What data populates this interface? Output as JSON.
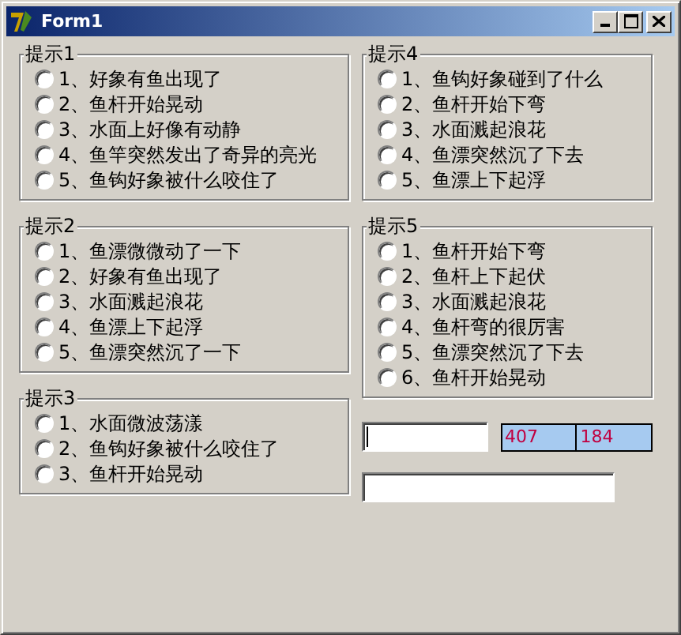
{
  "window": {
    "title": "Form1"
  },
  "left_groups": [
    {
      "title": "提示1",
      "options": [
        {
          "label": "1、好象有鱼出现了",
          "selected": false
        },
        {
          "label": "2、鱼杆开始晃动",
          "selected": false
        },
        {
          "label": "3、水面上好像有动静",
          "selected": false
        },
        {
          "label": "4、鱼竿突然发出了奇异的亮光",
          "selected": false
        },
        {
          "label": "5、鱼钩好象被什么咬住了",
          "selected": false
        }
      ]
    },
    {
      "title": "提示2",
      "options": [
        {
          "label": "1、鱼漂微微动了一下",
          "selected": false
        },
        {
          "label": "2、好象有鱼出现了",
          "selected": false
        },
        {
          "label": "3、水面溅起浪花",
          "selected": false
        },
        {
          "label": "4、鱼漂上下起浮",
          "selected": false
        },
        {
          "label": "5、鱼漂突然沉了一下",
          "selected": false
        }
      ]
    },
    {
      "title": "提示3",
      "options": [
        {
          "label": "1、水面微波荡漾",
          "selected": false
        },
        {
          "label": "2、鱼钩好象被什么咬住了",
          "selected": false
        },
        {
          "label": "3、鱼杆开始晃动",
          "selected": false
        }
      ]
    }
  ],
  "right_groups": [
    {
      "title": "提示4",
      "options": [
        {
          "label": "1、鱼钩好象碰到了什么",
          "selected": false
        },
        {
          "label": "2、鱼杆开始下弯",
          "selected": false
        },
        {
          "label": "3、水面溅起浪花",
          "selected": false
        },
        {
          "label": "4、鱼漂突然沉了下去",
          "selected": false
        },
        {
          "label": "5、鱼漂上下起浮",
          "selected": false
        }
      ]
    },
    {
      "title": "提示5",
      "options": [
        {
          "label": "1、鱼杆开始下弯",
          "selected": false
        },
        {
          "label": "2、鱼杆上下起伏",
          "selected": false
        },
        {
          "label": "3、水面溅起浪花",
          "selected": false
        },
        {
          "label": "4、鱼杆弯的很厉害",
          "selected": false
        },
        {
          "label": "5、鱼漂突然沉了下去",
          "selected": false
        },
        {
          "label": "6、鱼杆开始晃动",
          "selected": false
        }
      ]
    }
  ],
  "input_field": {
    "focused": true
  },
  "status_panels": [
    "407",
    "184"
  ],
  "second_field": {
    "focused": false
  }
}
